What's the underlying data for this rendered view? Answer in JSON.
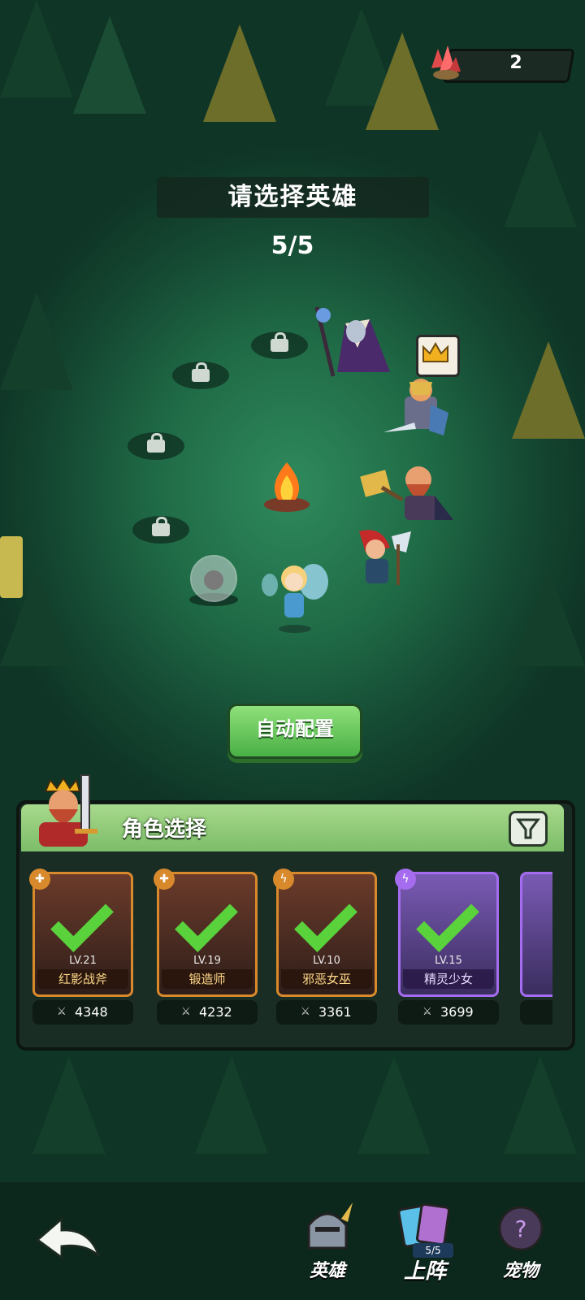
{
  "currency": {
    "crystals": "2"
  },
  "header": {
    "title": "请选择英雄",
    "team_count": "5/5"
  },
  "actions": {
    "auto_configure": "自动配置"
  },
  "panel": {
    "title": "角色选择",
    "heroes": [
      {
        "level": "LV.21",
        "name": "红影战斧",
        "power": "4348",
        "type": "strength",
        "selected": true
      },
      {
        "level": "LV.19",
        "name": "锻造师",
        "power": "4232",
        "type": "strength",
        "selected": true
      },
      {
        "level": "LV.10",
        "name": "邪恶女巫",
        "power": "3361",
        "type": "lightning",
        "selected": true
      },
      {
        "level": "LV.15",
        "name": "精灵少女",
        "power": "3699",
        "type": "lightning",
        "selected": true
      }
    ]
  },
  "nav": {
    "heroes": "英雄",
    "deploy": "上阵",
    "deploy_count": "5/5",
    "pets": "宠物"
  },
  "colors": {
    "accent_green": "#49b045",
    "card_orange": "#d8892c",
    "card_purple": "#a56cf0"
  }
}
